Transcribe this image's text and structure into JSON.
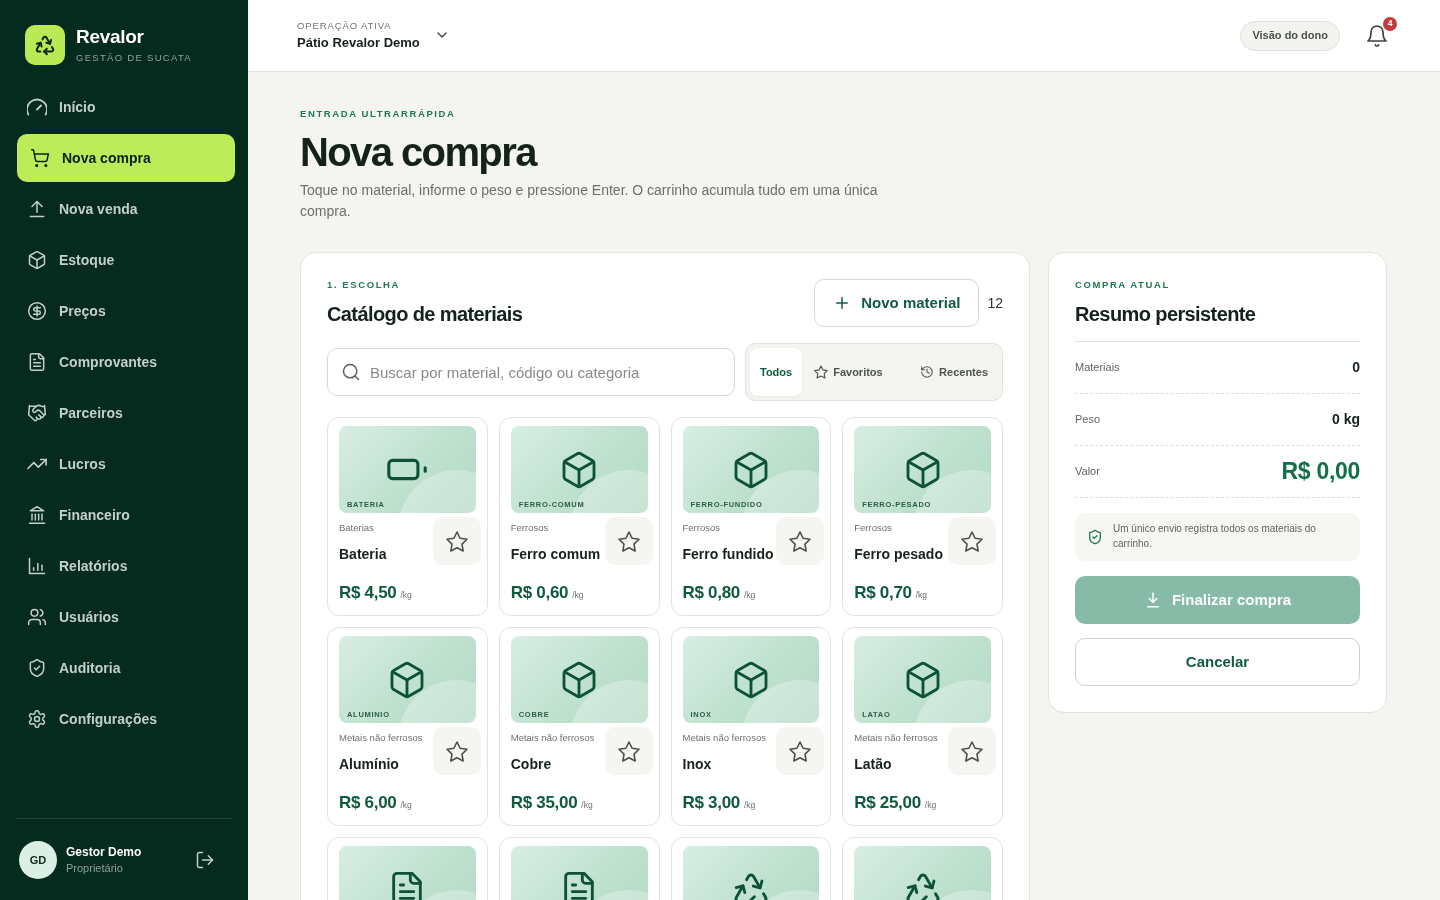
{
  "brand": {
    "name": "Revalor",
    "tagline": "GESTÃO DE SUCATA"
  },
  "sidebar": {
    "items": [
      {
        "label": "Início",
        "selected": false
      },
      {
        "label": "Nova compra",
        "selected": true
      },
      {
        "label": "Nova venda",
        "selected": false
      },
      {
        "label": "Estoque",
        "selected": false
      },
      {
        "label": "Preços",
        "selected": false
      },
      {
        "label": "Comprovantes",
        "selected": false
      },
      {
        "label": "Parceiros",
        "selected": false
      },
      {
        "label": "Lucros",
        "selected": false
      },
      {
        "label": "Financeiro",
        "selected": false
      },
      {
        "label": "Relatórios",
        "selected": false
      },
      {
        "label": "Usuários",
        "selected": false
      },
      {
        "label": "Auditoria",
        "selected": false
      },
      {
        "label": "Configurações",
        "selected": false
      }
    ]
  },
  "user": {
    "initials": "GD",
    "name": "Gestor Demo",
    "role": "Proprietário"
  },
  "topbar": {
    "eyebrow": "OPERAÇÃO ATIVA",
    "operation": "Pátio Revalor Demo",
    "owner_view_button": "Visão do dono",
    "notifications": "4"
  },
  "page": {
    "eyebrow": "ENTRADA ULTRARRÁPIDA",
    "title": "Nova compra",
    "description": "Toque no material, informe o peso e pressione Enter. O carrinho acumula tudo em uma única compra."
  },
  "catalog": {
    "eyebrow": "1. ESCOLHA",
    "title": "Catálogo de materiais",
    "new_button": "Novo material",
    "count": "12",
    "search": {
      "placeholder": "Buscar por material, código ou categoria"
    },
    "filters": [
      {
        "label": "Todos",
        "selected": true
      },
      {
        "label": "Favoritos",
        "selected": false
      },
      {
        "label": "Recentes",
        "selected": false
      }
    ],
    "materials": [
      {
        "kind": "battery",
        "code": "BATERIA",
        "category": "Baterias",
        "name": "Bateria",
        "price": "R$ 4,50",
        "unit": "/kg",
        "starred": false
      },
      {
        "kind": "box",
        "code": "FERRO-COMUM",
        "category": "Ferrosos",
        "name": "Ferro comum",
        "price": "R$ 0,60",
        "unit": "/kg",
        "starred": false
      },
      {
        "kind": "box",
        "code": "FERRO-FUNDIDO",
        "category": "Ferrosos",
        "name": "Ferro fundido",
        "price": "R$ 0,80",
        "unit": "/kg",
        "starred": false
      },
      {
        "kind": "box",
        "code": "FERRO-PESADO",
        "category": "Ferrosos",
        "name": "Ferro pesado",
        "price": "R$ 0,70",
        "unit": "/kg",
        "starred": false
      },
      {
        "kind": "box",
        "code": "ALUMINIO",
        "category": "Metais não ferrosos",
        "name": "Alumínio",
        "price": "R$ 6,00",
        "unit": "/kg",
        "starred": false
      },
      {
        "kind": "box",
        "code": "COBRE",
        "category": "Metais não ferrosos",
        "name": "Cobre",
        "price": "R$ 35,00",
        "unit": "/kg",
        "starred": false
      },
      {
        "kind": "box",
        "code": "INOX",
        "category": "Metais não ferrosos",
        "name": "Inox",
        "price": "R$ 3,00",
        "unit": "/kg",
        "starred": false
      },
      {
        "kind": "box",
        "code": "LATAO",
        "category": "Metais não ferrosos",
        "name": "Latão",
        "price": "R$ 25,00",
        "unit": "/kg",
        "starred": false
      },
      {
        "kind": "document"
      },
      {
        "kind": "document"
      },
      {
        "kind": "recycle"
      },
      {
        "kind": "recycle"
      }
    ]
  },
  "summary": {
    "eyebrow": "COMPRA ATUAL",
    "title": "Resumo persistente",
    "rows": [
      {
        "label": "Materiais",
        "value": "0",
        "kind": "plain"
      },
      {
        "label": "Peso",
        "value": "0 kg",
        "kind": "plain"
      },
      {
        "label": "Valor",
        "value": "R$ 0,00",
        "kind": "total"
      }
    ],
    "note": "Um único envio registra todos os materiais do carrinho.",
    "finish_button": {
      "label": "Finalizar compra",
      "disabled": true
    },
    "cancel_button": "Cancelar"
  }
}
